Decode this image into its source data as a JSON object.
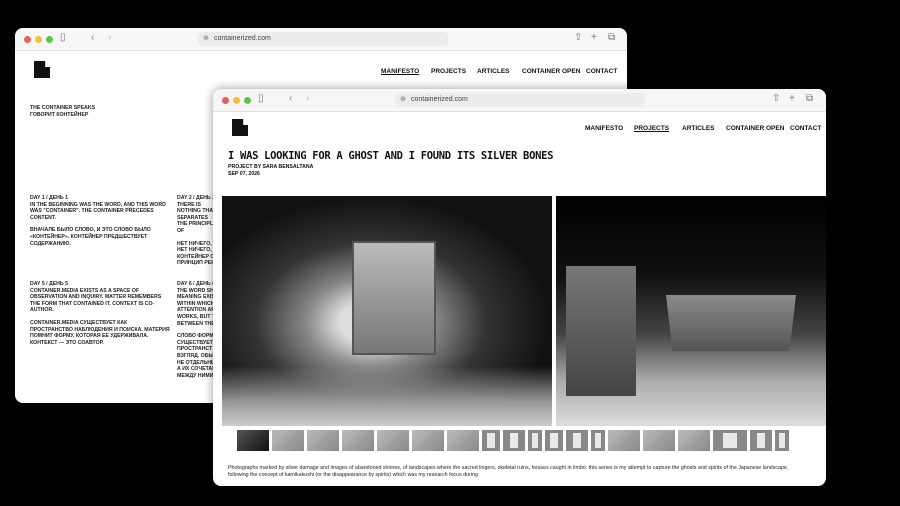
{
  "browser": {
    "url": "containerized.com"
  },
  "nav": [
    "MANIFESTO",
    "PROJECTS",
    "ARTICLES",
    "CONTAINER OPEN",
    "CONTACT"
  ],
  "manifesto": {
    "heading_en": "THE CONTAINER SPEAKS",
    "heading_ru": "ГОВОРИТ КОНТЕЙНЕР",
    "day1": {
      "label": "DAY 1 / ДЕНЬ 1",
      "en": "IN THE BEGINNING WAS THE WORD, AND THIS WORD WAS \"CONTAINER\". THE CONTAINER PRECEDES CONTENT.",
      "ru": "ВНАЧАЛЕ БЫЛО СЛОВО, И ЭТО СЛОВО БЫЛО «КОНТЕЙНЕР». КОНТЕЙНЕР ПРЕДШЕСТВУЕТ СОДЕРЖАНИЮ."
    },
    "day2": {
      "label": "DAY 2 / ДЕНЬ 2",
      "en": "THERE IS NOTHING THAT SEPARATES THE PRINCIPLE OF",
      "ru": "НЕТ НИЧЕГО, НЕТ НИЧЕГО, КОНТЕЙНЕР О ПРИНЦИП РЕК"
    },
    "day5": {
      "label": "DAY 5 / ДЕНЬ 5",
      "en": "CONTAINER.MEDIA EXISTS AS A SPACE OF OBSERVATION AND INQUIRY. MATTER REMEMBERS THE FORM THAT CONTAINED IT. CONTEXT IS CO-AUTHOR.",
      "ru": "CONTAINER.MEDIA СУЩЕСТВУЕТ КАК ПРОСТРАНСТВО НАБЛЮДЕНИЯ И ПОИСКА. МАТЕРИЯ ПОМНИТ ФОРМУ, КОТОРАЯ ЕЕ УДЕРЖИВАЛА. КОНТЕКСТ — ЭТО СОАВТОР."
    },
    "day6": {
      "label": "DAY 6 / ДЕНЬ 6",
      "en": "THE WORD SH MEANING EXIS WITHIN WHICH ATTENTION AR WORKS, BUT T BETWEEN THE",
      "ru": "СЛОВО ФОРМ СУЩЕСТВУЕТ ПРОСТРАНСТ ВЗГЛЯД. ОБЫ НЕ ОТДЕЛЬНЫ А ИХ СОЧЕТАН МЕЖДУ НИМИ"
    }
  },
  "project": {
    "title": "I WAS LOOKING FOR A GHOST AND I FOUND ITS SILVER BONES",
    "author": "PROJECT BY SARA BENSALTANA",
    "date": "SEP 07, 2026",
    "description": "Photographs marked by silver damage and images of abandoned shrines, of landscapes where the sacred lingers, skeletal ruins, houses caught in limbo: this series is my attempt to capture the ghosts and spirits of the Japanese landscape, following the concept of kamikakushi (or the disappearance by spirits) which was my research focus during",
    "thumbnails": [
      "photo",
      "photo",
      "photo",
      "photo",
      "photo",
      "photo",
      "photo",
      "doc",
      "doc",
      "doc",
      "doc",
      "doc",
      "doc",
      "photo",
      "photo",
      "photo",
      "doc",
      "doc",
      "doc"
    ]
  }
}
